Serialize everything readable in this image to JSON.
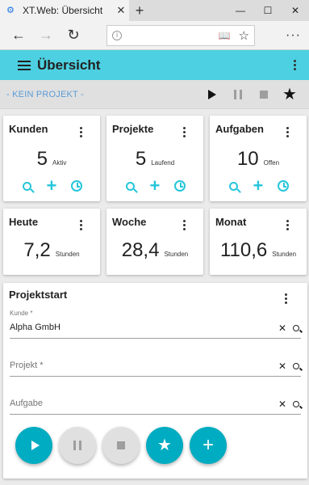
{
  "browser": {
    "tab_title": "XT.Web: Übersicht",
    "tab_close": "✕",
    "new_tab": "+",
    "win_min": "—",
    "win_max": "☐",
    "win_close": "✕",
    "back": "←",
    "forward": "→",
    "reload": "↻",
    "info_glyph": "i",
    "reading_glyph": "📖",
    "favorite": "☆",
    "more": "···"
  },
  "app": {
    "title": "Übersicht",
    "accent": "#4dd0e1",
    "icon_accent": "#26c6da",
    "project_label": "- KEIN PROJEKT -"
  },
  "cards": [
    {
      "title": "Kunden",
      "value": "5",
      "unit": "Aktiv"
    },
    {
      "title": "Projekte",
      "value": "5",
      "unit": "Laufend"
    },
    {
      "title": "Aufgaben",
      "value": "10",
      "unit": "Offen"
    },
    {
      "title": "Heute",
      "value": "7,2",
      "unit": "Stunden"
    },
    {
      "title": "Woche",
      "value": "28,4",
      "unit": "Stunden"
    },
    {
      "title": "Monat",
      "value": "110,6",
      "unit": "Stunden"
    }
  ],
  "projektstart": {
    "title": "Projektstart",
    "kunde_label": "Kunde *",
    "kunde_value": "Alpha GmbH",
    "projekt_placeholder": "Projekt *",
    "aufgabe_placeholder": "Aufgabe",
    "clear_glyph": "✕",
    "star_glyph": "★",
    "plus_glyph": "+"
  }
}
